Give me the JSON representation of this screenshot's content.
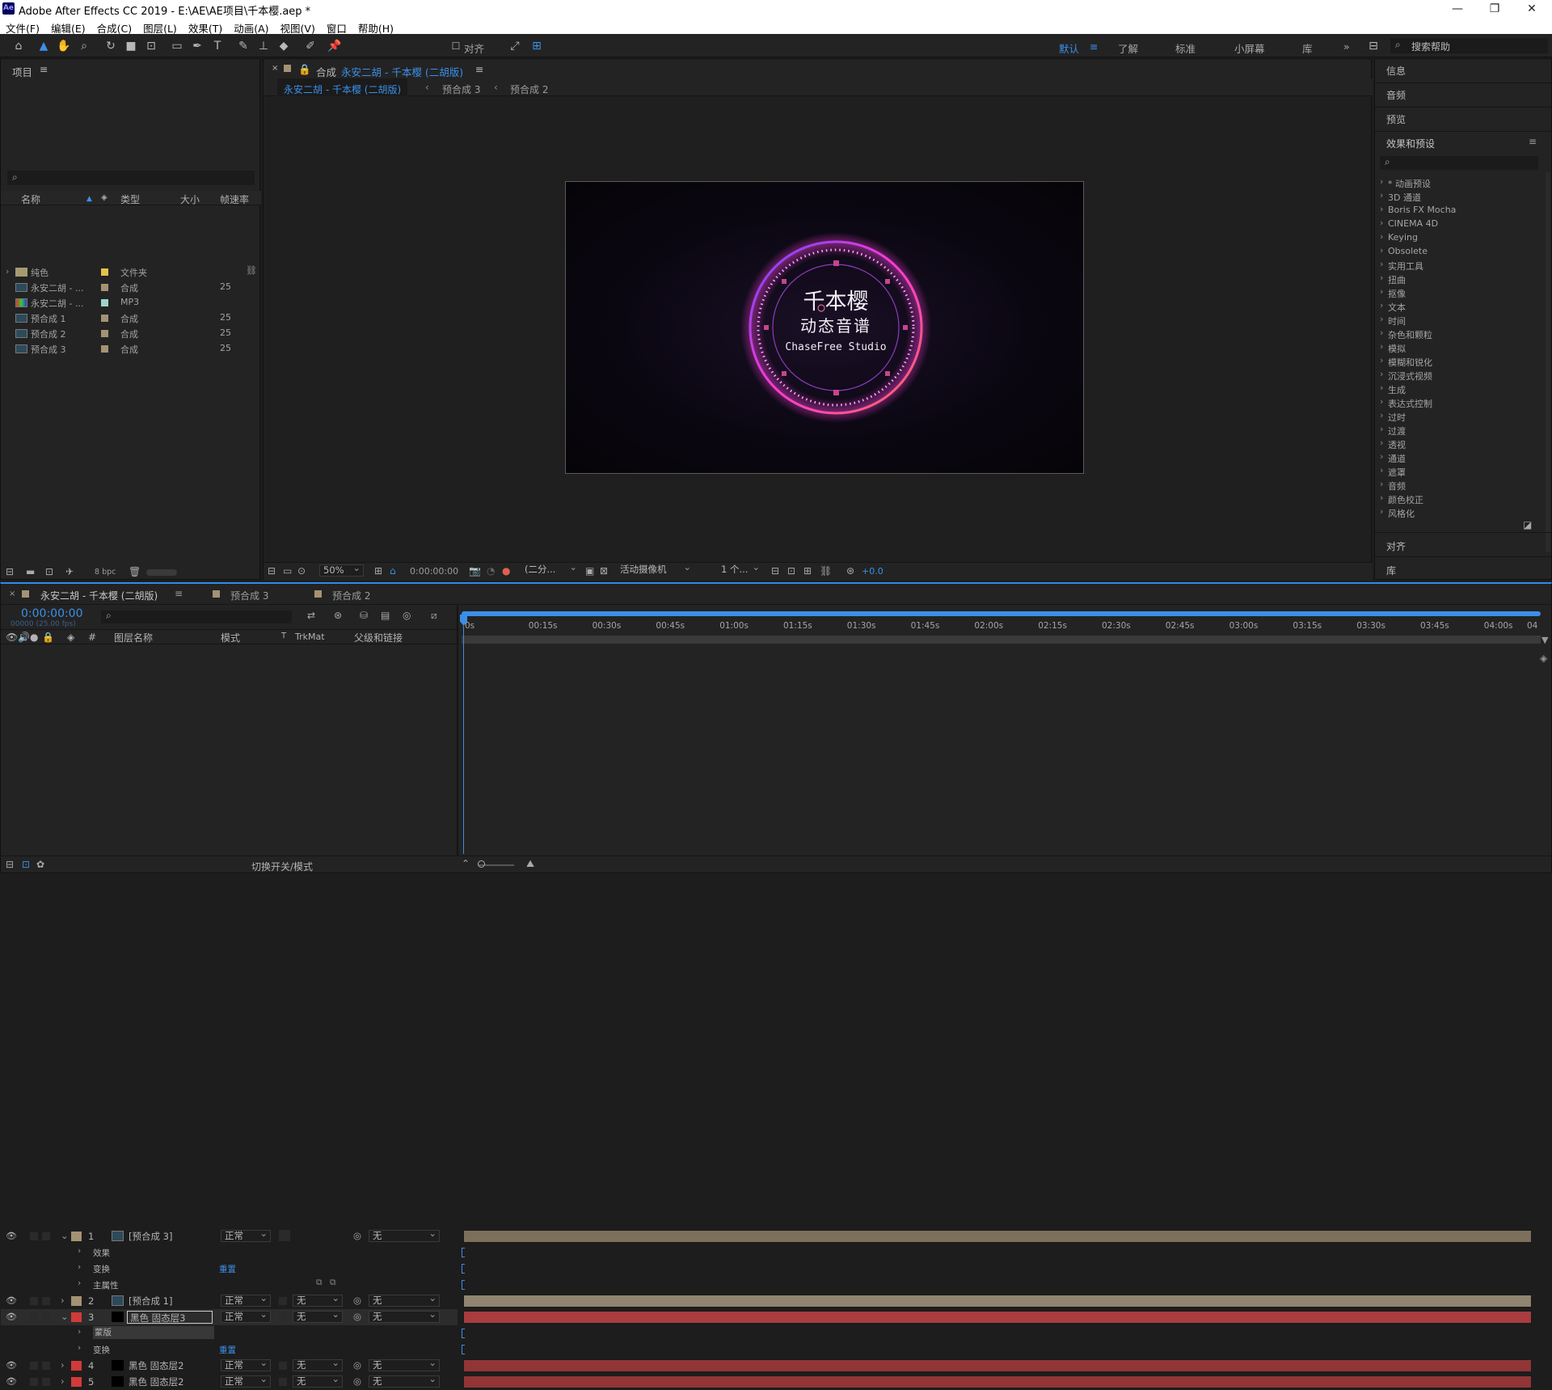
{
  "app": {
    "title": "Adobe After Effects CC 2019 - E:\\AE\\AE项目\\千本樱.aep *",
    "logo": "Ae",
    "window_controls": [
      "—",
      "❐",
      "✕"
    ]
  },
  "menu": [
    "文件(F)",
    "编辑(E)",
    "合成(C)",
    "图层(L)",
    "效果(T)",
    "动画(A)",
    "视图(V)",
    "窗口",
    "帮助(H)"
  ],
  "toolbar": {
    "align_label": "对齐",
    "workspaces": [
      "默认",
      "了解",
      "标准",
      "小屏幕",
      "库"
    ],
    "active_workspace": "默认",
    "more": "»",
    "search_help": "搜索帮助"
  },
  "project_panel": {
    "title": "项目",
    "columns": [
      "名称",
      "类型",
      "大小",
      "帧速率"
    ],
    "items": [
      {
        "name": "纯色",
        "type": "文件夹",
        "fps": "",
        "label_color": "#e5c24a",
        "icon": "folder-icon"
      },
      {
        "name": "永安二胡 - ...",
        "type": "合成",
        "fps": "25",
        "label_color": "#a49274",
        "icon": "composition-icon"
      },
      {
        "name": "永安二胡 - ...",
        "type": "MP3",
        "fps": "",
        "label_color": "#9fd4c8",
        "icon": "audio-icon"
      },
      {
        "name": "预合成 1",
        "type": "合成",
        "fps": "25",
        "label_color": "#a49274",
        "icon": "composition-icon"
      },
      {
        "name": "预合成 2",
        "type": "合成",
        "fps": "25",
        "label_color": "#a49274",
        "icon": "composition-icon"
      },
      {
        "name": "预合成 3",
        "type": "合成",
        "fps": "25",
        "label_color": "#a49274",
        "icon": "composition-icon"
      }
    ],
    "bpc": "8 bpc"
  },
  "composition": {
    "panel_prefix": "合成",
    "name": "永安二胡 - 千本樱 (二胡版)",
    "breadcrumbs": [
      "永安二胡 - 千本樱 (二胡版)",
      "预合成 3",
      "预合成 2"
    ],
    "preview": {
      "title": "千本樱",
      "subtitle": "动态音谱",
      "studio": "ChaseFree Studio"
    },
    "footer": {
      "zoom": "50%",
      "timecode": "0:00:00:00",
      "resolution": "(二分...",
      "camera": "活动摄像机",
      "views": "1 个...",
      "exposure": "+0.0"
    }
  },
  "right_panel": {
    "sections": [
      "信息",
      "音频",
      "预览"
    ],
    "effects_title": "效果和预设",
    "effects": [
      "* 动画预设",
      "3D 通道",
      "Boris FX Mocha",
      "CINEMA 4D",
      "Keying",
      "Obsolete",
      "实用工具",
      "扭曲",
      "抠像",
      "文本",
      "时间",
      "杂色和颗粒",
      "模拟",
      "模糊和锐化",
      "沉浸式视频",
      "生成",
      "表达式控制",
      "过时",
      "过渡",
      "透视",
      "通道",
      "遮罩",
      "音频",
      "颜色校正",
      "风格化"
    ],
    "bottom_sections": [
      "对齐",
      "库"
    ]
  },
  "timeline": {
    "tabs": [
      "永安二胡 - 千本樱 (二胡版)",
      "预合成 3",
      "预合成 2"
    ],
    "timecode": "0:00:00:00",
    "frame_info": "00000 (25.00 fps)",
    "columns": {
      "num": "#",
      "layer_name": "图层名称",
      "mode": "模式",
      "t": "T",
      "trkmat": "TrkMat",
      "parent": "父级和链接"
    },
    "ruler": [
      "0s",
      "00:15s",
      "00:30s",
      "00:45s",
      "01:00s",
      "01:15s",
      "01:30s",
      "01:45s",
      "02:00s",
      "02:15s",
      "02:30s",
      "02:45s",
      "03:00s",
      "03:15s",
      "03:30s",
      "03:45s",
      "04:00s",
      "04"
    ],
    "layers": [
      {
        "num": "1",
        "name": "[预合成 3]",
        "mode": "正常",
        "trkmat": "",
        "parent": "无",
        "label_color": "#a49274",
        "bar_color": "#7c705c",
        "expanded": true,
        "props": [
          {
            "name": "效果",
            "value": ""
          },
          {
            "name": "变换",
            "value": "重置"
          },
          {
            "name": "主属性",
            "value": ""
          }
        ]
      },
      {
        "num": "2",
        "name": "[预合成 1]",
        "mode": "正常",
        "trkmat": "无",
        "parent": "无",
        "label_color": "#a49274",
        "bar_color": "#8f8570",
        "expanded": false,
        "props": []
      },
      {
        "num": "3",
        "name": "黑色 固态层3",
        "mode": "正常",
        "trkmat": "无",
        "parent": "无",
        "label_color": "#d23a3a",
        "bar_color": "#a93c3e",
        "expanded": true,
        "props": [
          {
            "name": "蒙版",
            "value": ""
          },
          {
            "name": "变换",
            "value": "重置"
          }
        ]
      },
      {
        "num": "4",
        "name": "黑色 固态层2",
        "mode": "正常",
        "trkmat": "无",
        "parent": "无",
        "label_color": "#d23a3a",
        "bar_color": "#913537",
        "expanded": false,
        "props": []
      },
      {
        "num": "5",
        "name": "黑色 固态层2",
        "mode": "正常",
        "trkmat": "无",
        "parent": "无",
        "label_color": "#d23a3a",
        "bar_color": "#913537",
        "expanded": false,
        "props": []
      }
    ],
    "footer_toggle": "切换开关/模式"
  },
  "colors": {
    "accent": "#2d8ceb",
    "panel": "#232323",
    "background": "#1d1d1d"
  }
}
